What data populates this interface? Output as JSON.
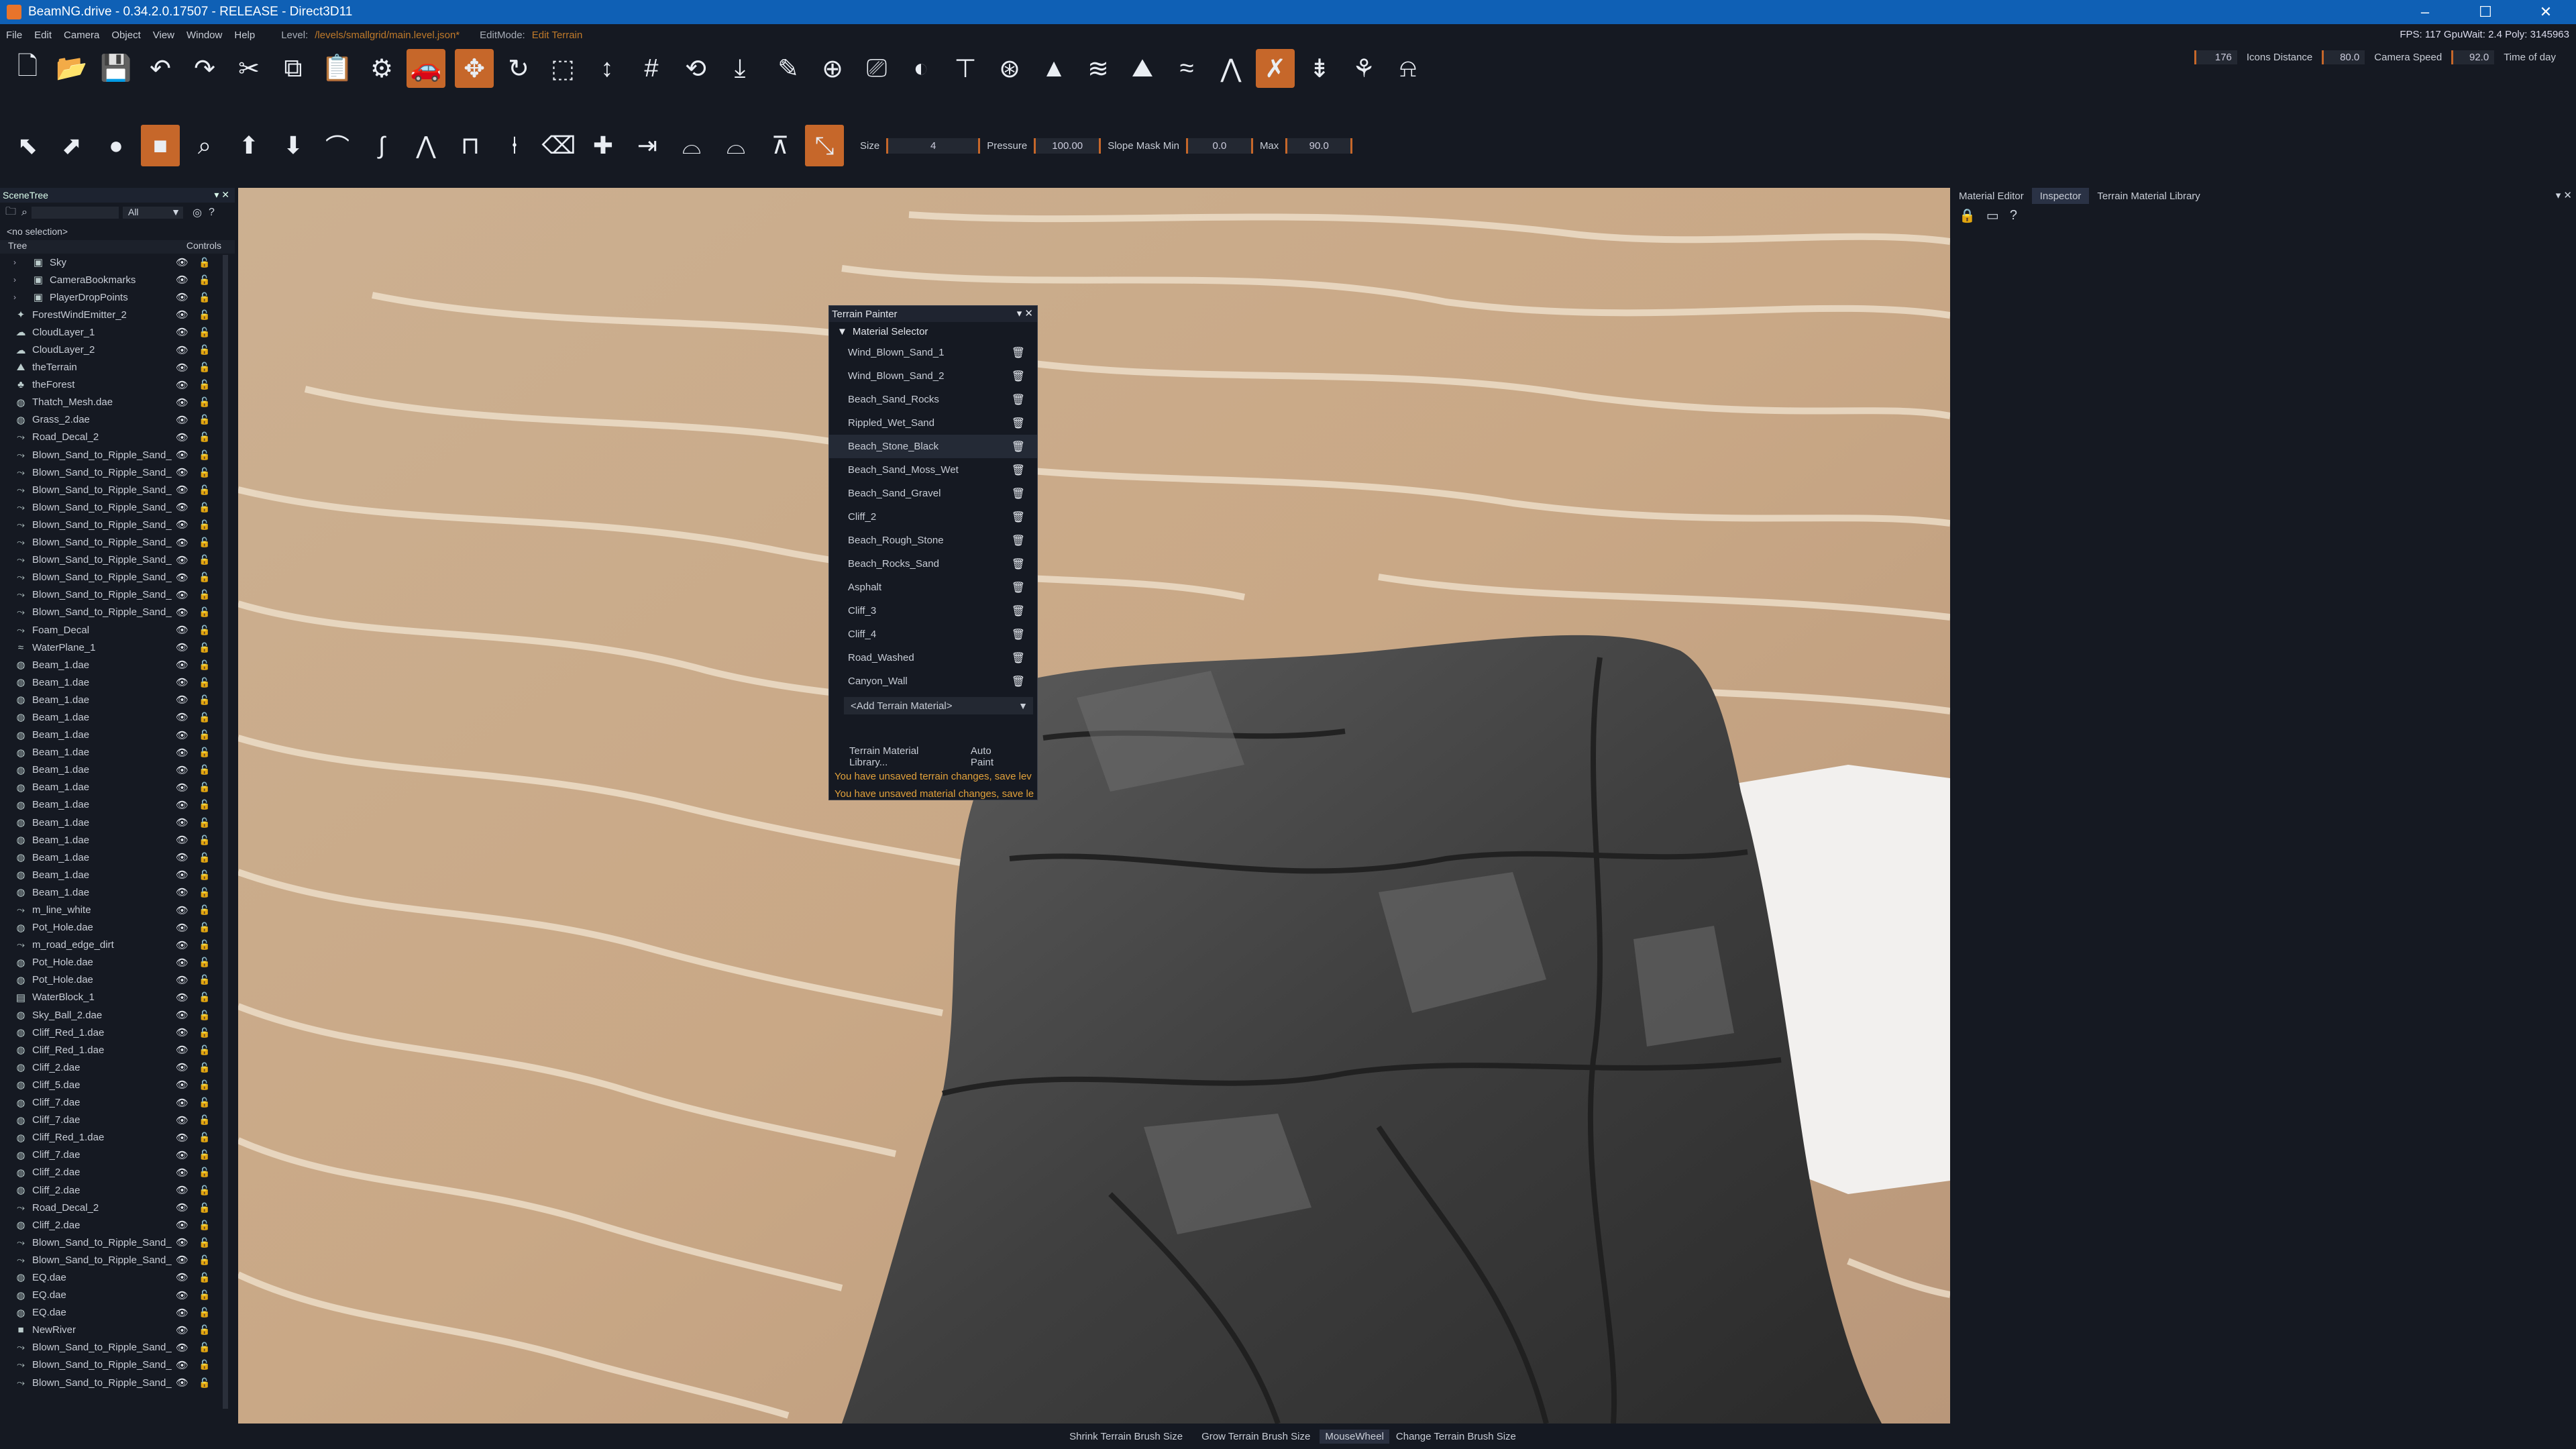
{
  "window": {
    "title": "BeamNG.drive - 0.34.2.0.17507 - RELEASE - Direct3D11",
    "minimize": "–",
    "maximize": "☐",
    "close": "✕"
  },
  "menu": {
    "items": [
      "File",
      "Edit",
      "Camera",
      "Object",
      "View",
      "Window",
      "Help"
    ],
    "level_label": "Level:",
    "level_path": "/levels/smallgrid/main.level.json*",
    "editmode_label": "EditMode:",
    "editmode_value": "Edit Terrain",
    "stats": "FPS: 117  GpuWait: 2.4  Poly: 3145963"
  },
  "camera": {
    "count": "176",
    "icons_label": "Icons Distance",
    "icons_value": "80.0",
    "speed_label": "Camera Speed",
    "speed_value": "92.0",
    "tod_label": "Time of day"
  },
  "brush": {
    "size_label": "Size",
    "size": "4",
    "pressure_label": "Pressure",
    "pressure": "100.00",
    "slope_label": "Slope Mask  Min",
    "slope_min": "0.0",
    "max_label": "Max",
    "slope_max": "90.0"
  },
  "scenetree": {
    "title": "SceneTree",
    "filter": "All",
    "nosel": "<no selection>",
    "col_tree": "Tree",
    "col_controls": "Controls",
    "rows": [
      {
        "label": "Sky",
        "icon": "▣",
        "exp": true
      },
      {
        "label": "CameraBookmarks",
        "icon": "▣",
        "exp": true
      },
      {
        "label": "PlayerDropPoints",
        "icon": "▣",
        "exp": true
      },
      {
        "label": "ForestWindEmitter_2",
        "icon": "✦"
      },
      {
        "label": "CloudLayer_1",
        "icon": "☁"
      },
      {
        "label": "CloudLayer_2",
        "icon": "☁"
      },
      {
        "label": "theTerrain",
        "icon": "⛰"
      },
      {
        "label": "theForest",
        "icon": "♣"
      },
      {
        "label": "Thatch_Mesh.dae",
        "icon": "◍"
      },
      {
        "label": "Grass_2.dae",
        "icon": "◍"
      },
      {
        "label": "Road_Decal_2",
        "icon": "⤳"
      },
      {
        "label": "Blown_Sand_to_Ripple_Sand_",
        "icon": "⤳"
      },
      {
        "label": "Blown_Sand_to_Ripple_Sand_",
        "icon": "⤳"
      },
      {
        "label": "Blown_Sand_to_Ripple_Sand_",
        "icon": "⤳"
      },
      {
        "label": "Blown_Sand_to_Ripple_Sand_",
        "icon": "⤳"
      },
      {
        "label": "Blown_Sand_to_Ripple_Sand_",
        "icon": "⤳"
      },
      {
        "label": "Blown_Sand_to_Ripple_Sand_",
        "icon": "⤳"
      },
      {
        "label": "Blown_Sand_to_Ripple_Sand_",
        "icon": "⤳"
      },
      {
        "label": "Blown_Sand_to_Ripple_Sand_",
        "icon": "⤳"
      },
      {
        "label": "Blown_Sand_to_Ripple_Sand_",
        "icon": "⤳"
      },
      {
        "label": "Blown_Sand_to_Ripple_Sand_",
        "icon": "⤳"
      },
      {
        "label": "Foam_Decal",
        "icon": "⤳"
      },
      {
        "label": "WaterPlane_1",
        "icon": "≈"
      },
      {
        "label": "Beam_1.dae",
        "icon": "◍"
      },
      {
        "label": "Beam_1.dae",
        "icon": "◍"
      },
      {
        "label": "Beam_1.dae",
        "icon": "◍"
      },
      {
        "label": "Beam_1.dae",
        "icon": "◍"
      },
      {
        "label": "Beam_1.dae",
        "icon": "◍"
      },
      {
        "label": "Beam_1.dae",
        "icon": "◍"
      },
      {
        "label": "Beam_1.dae",
        "icon": "◍"
      },
      {
        "label": "Beam_1.dae",
        "icon": "◍"
      },
      {
        "label": "Beam_1.dae",
        "icon": "◍"
      },
      {
        "label": "Beam_1.dae",
        "icon": "◍"
      },
      {
        "label": "Beam_1.dae",
        "icon": "◍"
      },
      {
        "label": "Beam_1.dae",
        "icon": "◍"
      },
      {
        "label": "Beam_1.dae",
        "icon": "◍"
      },
      {
        "label": "Beam_1.dae",
        "icon": "◍"
      },
      {
        "label": "m_line_white",
        "icon": "⤳"
      },
      {
        "label": "Pot_Hole.dae",
        "icon": "◍"
      },
      {
        "label": "m_road_edge_dirt",
        "icon": "⤳"
      },
      {
        "label": "Pot_Hole.dae",
        "icon": "◍"
      },
      {
        "label": "Pot_Hole.dae",
        "icon": "◍"
      },
      {
        "label": "WaterBlock_1",
        "icon": "▤"
      },
      {
        "label": "Sky_Ball_2.dae",
        "icon": "◍"
      },
      {
        "label": "Cliff_Red_1.dae",
        "icon": "◍"
      },
      {
        "label": "Cliff_Red_1.dae",
        "icon": "◍"
      },
      {
        "label": "Cliff_2.dae",
        "icon": "◍"
      },
      {
        "label": "Cliff_5.dae",
        "icon": "◍"
      },
      {
        "label": "Cliff_7.dae",
        "icon": "◍"
      },
      {
        "label": "Cliff_7.dae",
        "icon": "◍"
      },
      {
        "label": "Cliff_Red_1.dae",
        "icon": "◍"
      },
      {
        "label": "Cliff_7.dae",
        "icon": "◍"
      },
      {
        "label": "Cliff_2.dae",
        "icon": "◍"
      },
      {
        "label": "Cliff_2.dae",
        "icon": "◍"
      },
      {
        "label": "Road_Decal_2",
        "icon": "⤳"
      },
      {
        "label": "Cliff_2.dae",
        "icon": "◍"
      },
      {
        "label": "Blown_Sand_to_Ripple_Sand_",
        "icon": "⤳"
      },
      {
        "label": "Blown_Sand_to_Ripple_Sand_",
        "icon": "⤳"
      },
      {
        "label": "EQ.dae",
        "icon": "◍"
      },
      {
        "label": "EQ.dae",
        "icon": "◍"
      },
      {
        "label": "EQ.dae",
        "icon": "◍"
      },
      {
        "label": "NewRiver",
        "icon": "■"
      },
      {
        "label": "Blown_Sand_to_Ripple_Sand_",
        "icon": "⤳"
      },
      {
        "label": "Blown_Sand_to_Ripple_Sand_",
        "icon": "⤳"
      },
      {
        "label": "Blown_Sand_to_Ripple_Sand_",
        "icon": "⤳"
      }
    ]
  },
  "terrain_painter": {
    "title": "Terrain Painter",
    "section": "Material Selector",
    "materials": [
      "Wind_Blown_Sand_1",
      "Wind_Blown_Sand_2",
      "Beach_Sand_Rocks",
      "Rippled_Wet_Sand",
      "Beach_Stone_Black",
      "Beach_Sand_Moss_Wet",
      "Beach_Sand_Gravel",
      "Cliff_2",
      "Beach_Rough_Stone",
      "Beach_Rocks_Sand",
      "Asphalt",
      "Cliff_3",
      "Cliff_4",
      "Road_Washed",
      "Canyon_Wall"
    ],
    "selected_index": 4,
    "add_label": "<Add Terrain Material>",
    "lib_button": "Terrain Material Library...",
    "auto_button": "Auto Paint",
    "warn1": "You have unsaved terrain changes, save lev",
    "warn2": "You have unsaved material changes, save le"
  },
  "right_panel": {
    "tabs": [
      "Material Editor",
      "Inspector",
      "Terrain Material Library"
    ],
    "active_tab": 1
  },
  "status": {
    "shrink": "Shrink Terrain Brush Size",
    "grow": "Grow Terrain Brush Size",
    "key": "MouseWheel",
    "change": "Change Terrain Brush Size"
  },
  "colors": {
    "accent": "#c6672a",
    "titlebar": "#0f60b5",
    "warning": "#e3a23b",
    "panel": "#151922"
  }
}
